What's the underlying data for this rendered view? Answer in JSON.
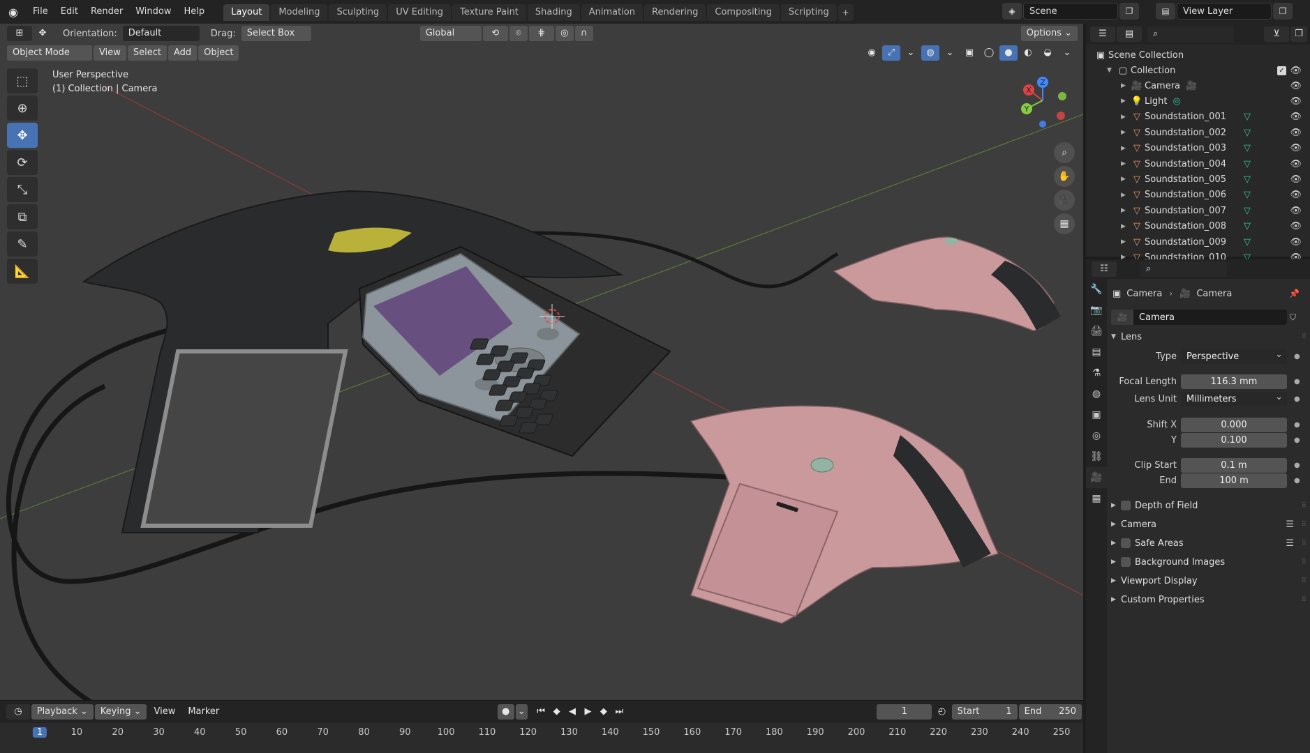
{
  "topbar": {
    "menus": [
      "File",
      "Edit",
      "Render",
      "Window",
      "Help"
    ],
    "workspaces": [
      "Layout",
      "Modeling",
      "Sculpting",
      "UV Editing",
      "Texture Paint",
      "Shading",
      "Animation",
      "Rendering",
      "Compositing",
      "Scripting"
    ],
    "active_workspace": "Layout",
    "scene": "Scene",
    "view_layer": "View Layer"
  },
  "viewport": {
    "orientation_label": "Orientation:",
    "orientation_value": "Default",
    "drag_label": "Drag:",
    "drag_value": "Select Box",
    "transform_space": "Global",
    "options": "Options",
    "mode": "Object Mode",
    "menus": [
      "View",
      "Select",
      "Add",
      "Object"
    ],
    "info_line1": "User Perspective",
    "info_line2": "(1) Collection | Camera",
    "gizmo": {
      "x": "X",
      "y": "Y",
      "z": "Z"
    }
  },
  "timeline": {
    "menus": [
      "Playback",
      "Keying",
      "View",
      "Marker"
    ],
    "current_frame": "1",
    "start_label": "Start",
    "start_value": "1",
    "end_label": "End",
    "end_value": "250",
    "ruler": [
      "1",
      "10",
      "20",
      "30",
      "40",
      "50",
      "60",
      "70",
      "80",
      "90",
      "100",
      "110",
      "120",
      "130",
      "140",
      "150",
      "160",
      "170",
      "180",
      "190",
      "200",
      "210",
      "220",
      "230",
      "240",
      "250"
    ]
  },
  "outliner": {
    "scene_collection": "Scene Collection",
    "collection": "Collection",
    "items": [
      "Camera",
      "Light",
      "Soundstation_001",
      "Soundstation_002",
      "Soundstation_003",
      "Soundstation_004",
      "Soundstation_005",
      "Soundstation_006",
      "Soundstation_007",
      "Soundstation_008",
      "Soundstation_009",
      "Soundstation_010"
    ]
  },
  "properties": {
    "breadcrumb_object": "Camera",
    "breadcrumb_data": "Camera",
    "datablock": "Camera",
    "lens_panel": "Lens",
    "type_label": "Type",
    "type_value": "Perspective",
    "focal_label": "Focal Length",
    "focal_value": "116.3 mm",
    "lens_unit_label": "Lens Unit",
    "lens_unit_value": "Millimeters",
    "shift_x_label": "Shift X",
    "shift_x_value": "0.000",
    "shift_y_label": "Y",
    "shift_y_value": "0.100",
    "clip_start_label": "Clip Start",
    "clip_start_value": "0.1 m",
    "clip_end_label": "End",
    "clip_end_value": "100 m",
    "panels": [
      "Depth of Field",
      "Camera",
      "Safe Areas",
      "Background Images",
      "Viewport Display",
      "Custom Properties"
    ]
  },
  "colors": {
    "accent": "#4772b3",
    "viewport_bg": "#3d3d3d",
    "object_data": "#33c7a0",
    "speaker_pink": "#c9999c",
    "screen_purple": "#67507f",
    "button_yellow": "#b9b13a"
  }
}
